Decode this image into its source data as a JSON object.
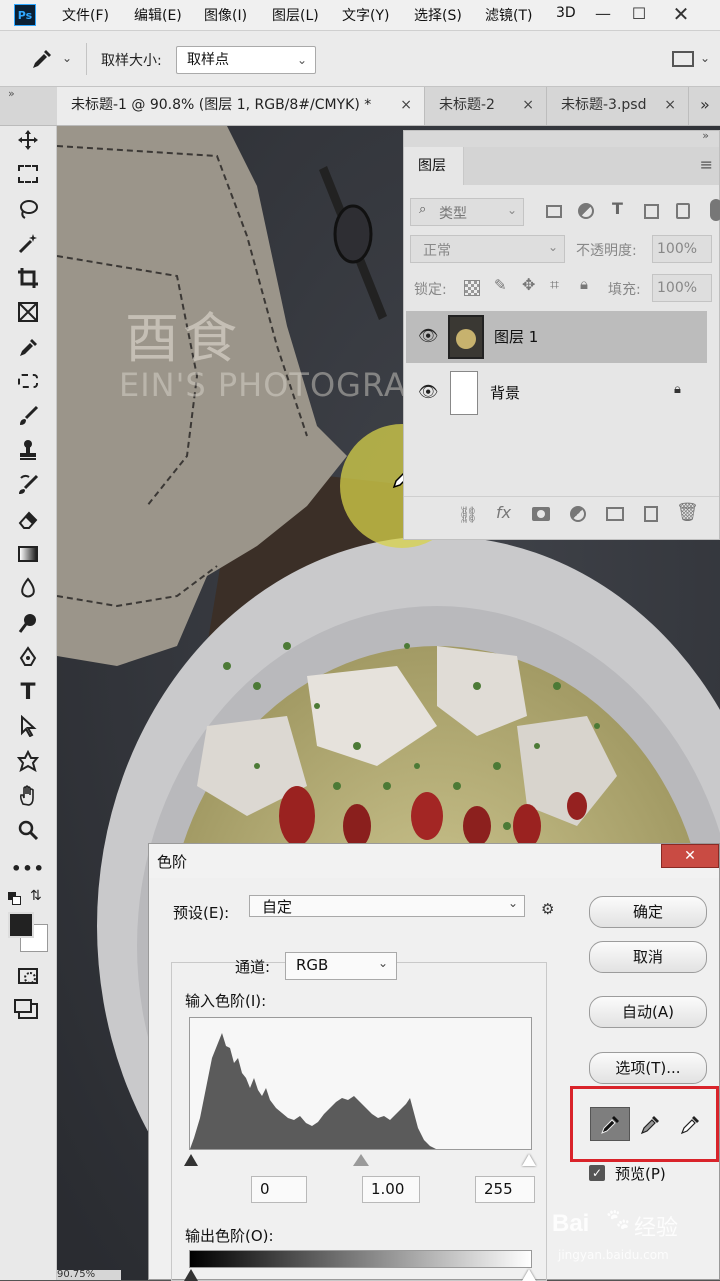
{
  "app": {
    "logo": "Ps"
  },
  "menubar": {
    "items": [
      "文件(F)",
      "编辑(E)",
      "图像(I)",
      "图层(L)",
      "文字(Y)",
      "选择(S)",
      "滤镜(T)",
      "3D"
    ]
  },
  "options_bar": {
    "sample_size_label": "取样大小:",
    "sample_size_value": "取样点"
  },
  "tabs": [
    {
      "label": "未标题-1 @ 90.8% (图层 1, RGB/8#/CMYK) *",
      "close": "×"
    },
    {
      "label": "未标题-2",
      "close": "×"
    },
    {
      "label": "未标题-3.psd",
      "close": "×"
    }
  ],
  "tabs_overflow": "»",
  "canvas": {
    "watermark_title": "酉食",
    "watermark_sub": "EIN'S PHOTOGRA",
    "zoom": "90.75%"
  },
  "layers_panel": {
    "title": "图层",
    "filter_kind": "类型",
    "blend_mode": "正常",
    "opacity_label": "不透明度:",
    "opacity_value": "100%",
    "lock_label": "锁定:",
    "fill_label": "填充:",
    "fill_value": "100%",
    "layers": [
      {
        "name": "图层 1",
        "selected": true
      },
      {
        "name": "背景",
        "locked": true
      }
    ]
  },
  "levels_dialog": {
    "title": "色阶",
    "close": "✕",
    "preset_label": "预设(E):",
    "preset_value": "自定",
    "channel_label": "通道:",
    "channel_value": "RGB",
    "input_label": "输入色阶(I):",
    "input_values": {
      "black": "0",
      "gamma": "1.00",
      "white": "255"
    },
    "output_label": "输出色阶(O):",
    "buttons": {
      "ok": "确定",
      "cancel": "取消",
      "auto": "自动(A)",
      "options": "选项(T)..."
    },
    "preview_label": "预览(P)",
    "preview_checked": true
  },
  "watermark": {
    "brand": "Bai",
    "brand2": "经验",
    "url": "jingyan.baidu.com"
  },
  "colors": {
    "accent_red": "#d9232a",
    "panel": "#e6e6e6",
    "toolbar": "#e9e9e9"
  }
}
